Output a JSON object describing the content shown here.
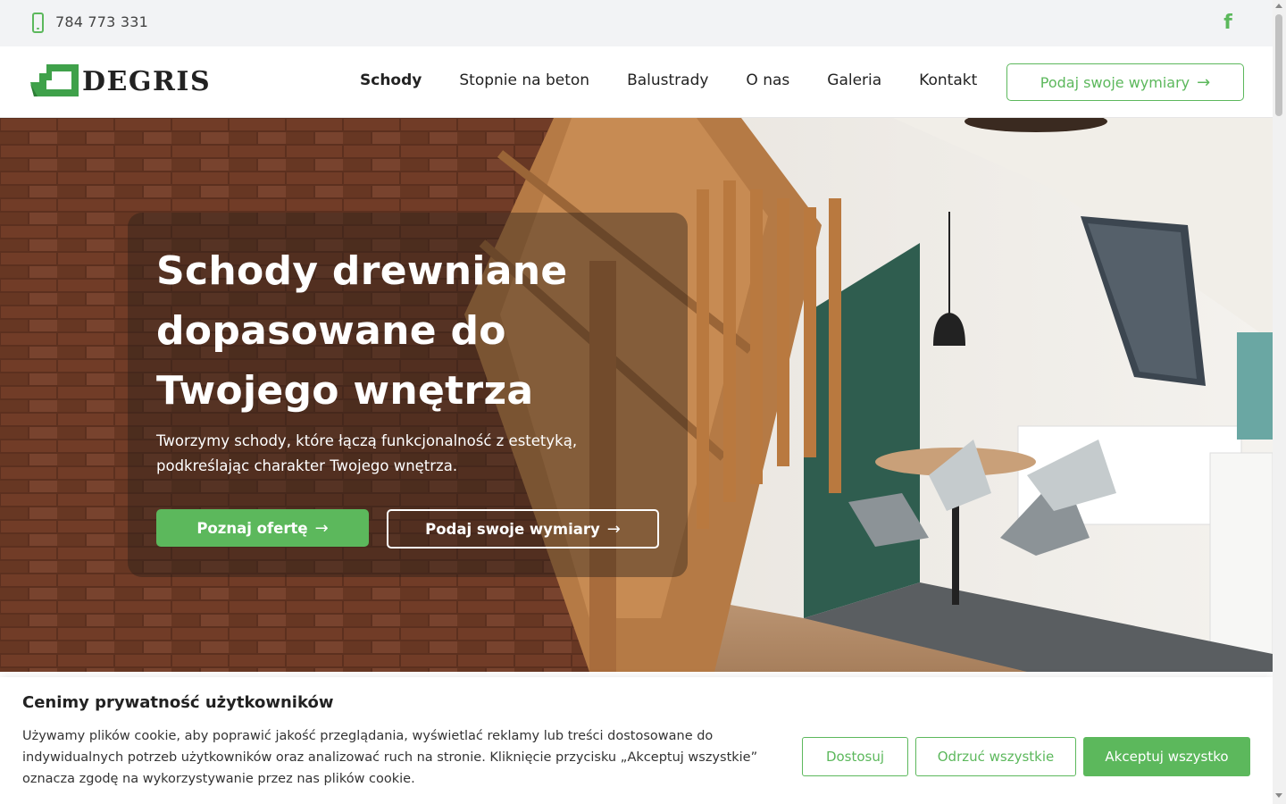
{
  "topbar": {
    "phone": "784 773 331",
    "phone_icon": "phone-icon",
    "social_icon": "facebook-icon",
    "social_glyph": "f"
  },
  "header": {
    "logo_text": "DEGRIS",
    "nav": [
      {
        "label": "Schody",
        "active": true
      },
      {
        "label": "Stopnie na beton",
        "active": false
      },
      {
        "label": "Balustrady",
        "active": false
      },
      {
        "label": "O nas",
        "active": false
      },
      {
        "label": "Galeria",
        "active": false
      },
      {
        "label": "Kontakt",
        "active": false
      }
    ],
    "cta_label": "Podaj swoje wymiary"
  },
  "hero": {
    "title": "Schody drewniane dopasowane do Twojego wnętrza",
    "subtitle": "Tworzymy schody, które łączą funkcjonalność z estetyką, podkreślając charakter Twojego wnętrza.",
    "primary_label": "Poznaj ofertę",
    "secondary_label": "Podaj swoje wymiary"
  },
  "cookie": {
    "title": "Cenimy prywatność użytkowników",
    "text": "Używamy plików cookie, aby poprawić jakość przeglądania, wyświetlać reklamy lub treści dostosowane do indywidualnych potrzeb użytkowników oraz analizować ruch na stronie. Kliknięcie przycisku „Akceptuj wszystkie” oznacza zgodę na wykorzystywanie przez nas plików cookie.",
    "customize_label": "Dostosuj",
    "reject_label": "Odrzuć wszystkie",
    "accept_label": "Akceptuj wszystko"
  },
  "colors": {
    "accent": "#5cb85c",
    "topbar_bg": "#f2f3f5"
  }
}
